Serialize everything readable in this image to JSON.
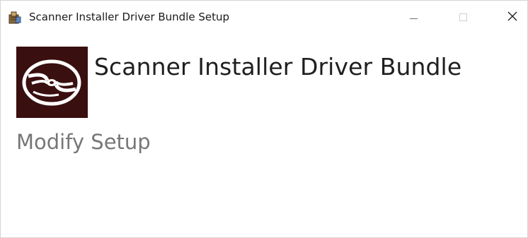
{
  "window": {
    "title": "Scanner Installer Driver Bundle Setup",
    "controls": {
      "minimize_icon": "minimize-icon",
      "maximize_icon": "maximize-icon",
      "close_icon": "close-icon",
      "close_glyph": "✕"
    }
  },
  "header": {
    "product_name": "Scanner Installer Driver Bundle",
    "logo_icon": "disc-icon",
    "logo_background": "#3a0f0f"
  },
  "main": {
    "heading": "Modify Setup"
  }
}
